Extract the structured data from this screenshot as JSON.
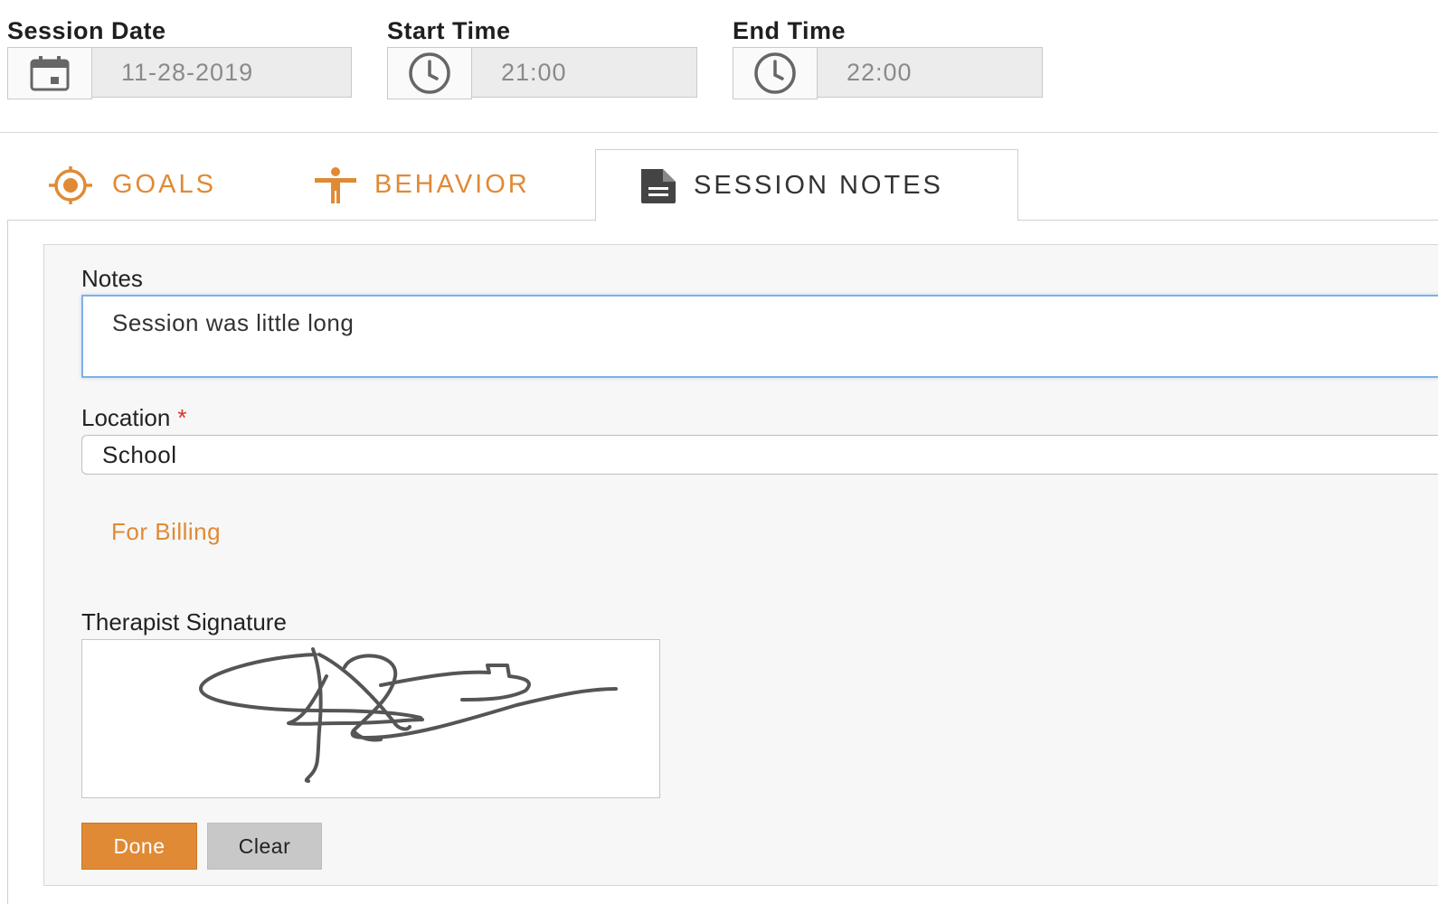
{
  "session_date": {
    "label": "Session Date",
    "value": "11-28-2019",
    "icon": "calendar-icon"
  },
  "start_time": {
    "label": "Start Time",
    "value": "21:00",
    "icon": "clock-icon"
  },
  "end_time": {
    "label": "End Time",
    "value": "22:00",
    "icon": "clock-icon"
  },
  "tabs": [
    {
      "label": "GOALS",
      "icon": "target-icon",
      "active": false
    },
    {
      "label": "BEHAVIOR",
      "icon": "person-icon",
      "active": false
    },
    {
      "label": "SESSION NOTES",
      "icon": "document-icon",
      "active": true
    }
  ],
  "notes": {
    "label": "Notes",
    "value": "Session was little long"
  },
  "location": {
    "label": "Location",
    "required_marker": "*",
    "value": "School"
  },
  "billing_link": "For Billing",
  "signature": {
    "label": "Therapist Signature"
  },
  "buttons": {
    "done": "Done",
    "clear": "Clear"
  },
  "colors": {
    "accent": "#e08a35",
    "required": "#d9312a",
    "focus_border": "#7fb0e6"
  }
}
